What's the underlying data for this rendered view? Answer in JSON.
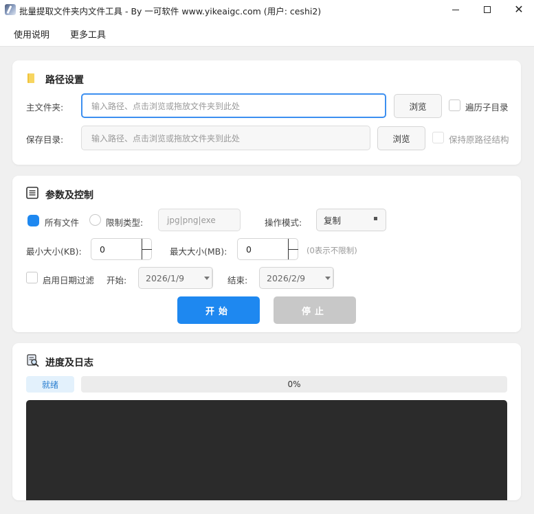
{
  "window": {
    "title": "批量提取文件夹内文件工具 - By 一可软件 www.yikeaigc.com (用户: ceshi2)",
    "minimize": "",
    "maximize": "",
    "close": "✕"
  },
  "menu": {
    "items": [
      "使用说明",
      "更多工具"
    ]
  },
  "path_settings": {
    "title": "路径设置",
    "main_folder_label": "主文件夹:",
    "main_folder_value": "",
    "main_folder_placeholder": "输入路径、点击浏览或拖放文件夹到此处",
    "browse_label": "浏览",
    "traverse_subdirs_label": "遍历子目录",
    "traverse_subdirs_checked": false,
    "save_dir_label": "保存目录:",
    "save_dir_value": "",
    "save_dir_placeholder": "输入路径、点击浏览或拖放文件夹到此处",
    "keep_structure_label": "保持原路径结构",
    "keep_structure_checked": false
  },
  "params": {
    "title": "参数及控制",
    "all_files_label": "所有文件",
    "all_files_selected": true,
    "limit_type_label": "限制类型:",
    "limit_type_placeholder": "jpg|png|exe",
    "mode_label": "操作模式:",
    "mode_value": "复制",
    "min_size_label": "最小大小(KB):",
    "min_size_value": "0",
    "max_size_label": "最大大小(MB):",
    "max_size_value": "0",
    "size_hint": "(0表示不限制)",
    "date_filter_label": "启用日期过滤",
    "date_filter_checked": false,
    "start_label": "开始:",
    "start_date": "2026/1/9",
    "end_label": "结束:",
    "end_date": "2026/2/9",
    "start_button": "开始",
    "stop_button": "停止"
  },
  "progress": {
    "title": "进度及日志",
    "status": "就绪",
    "percent_text": "0%",
    "percent": 0,
    "log": ""
  },
  "colors": {
    "accent": "#1e88f0",
    "disabled": "#c8c8c8",
    "log_bg": "#2b2b2b"
  }
}
